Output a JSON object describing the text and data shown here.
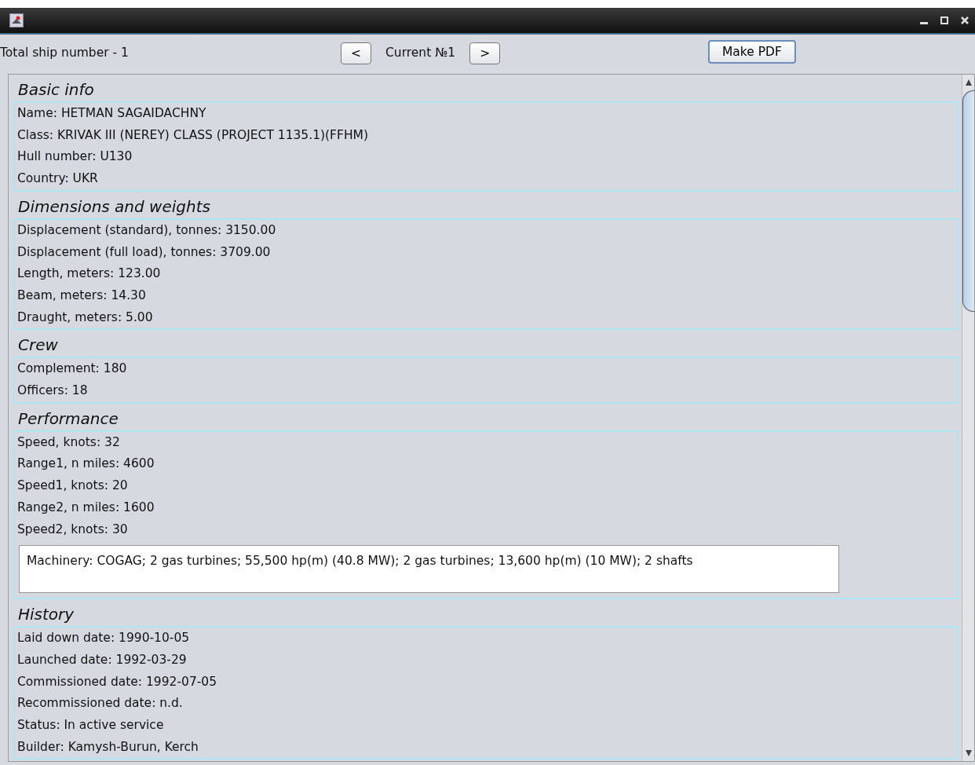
{
  "toolbar": {
    "total": "Total ship number - 1",
    "prev": "<",
    "current": "Current №1",
    "next": ">",
    "pdf": "Make PDF"
  },
  "sections": [
    {
      "title": "Basic info",
      "fields": [
        "Name: HETMAN SAGAIDACHNY",
        "Class: KRIVAK III (NEREY) CLASS (PROJECT 1135.1)(FFHM)",
        "Hull number: U130",
        "Country: UKR"
      ]
    },
    {
      "title": "Dimensions and weights",
      "fields": [
        "Displacement (standard), tonnes: 3150.00",
        "Displacement (full load), tonnes: 3709.00",
        "Length, meters: 123.00",
        "Beam, meters: 14.30",
        "Draught, meters: 5.00"
      ]
    },
    {
      "title": "Crew",
      "fields": [
        "Complement: 180",
        "Officers: 18"
      ]
    },
    {
      "title": "Performance",
      "fields": [
        "Speed, knots: 32",
        "Range1, n miles: 4600",
        "Speed1, knots: 20",
        "Range2, n miles: 1600",
        "Speed2, knots: 30"
      ],
      "note": "Machinery: COGAG; 2 gas turbines; 55,500 hp(m) (40.8 MW); 2 gas turbines; 13,600 hp(m) (10 MW); 2 shafts"
    },
    {
      "title": "History",
      "fields": [
        "Laid down date: 1990-10-05",
        "Launched date: 1992-03-29",
        "Commissioned date: 1992-07-05",
        "Recommissioned date: n.d.",
        "Status: In active service",
        "Builder: Kamysh-Burun, Kerch"
      ]
    }
  ]
}
